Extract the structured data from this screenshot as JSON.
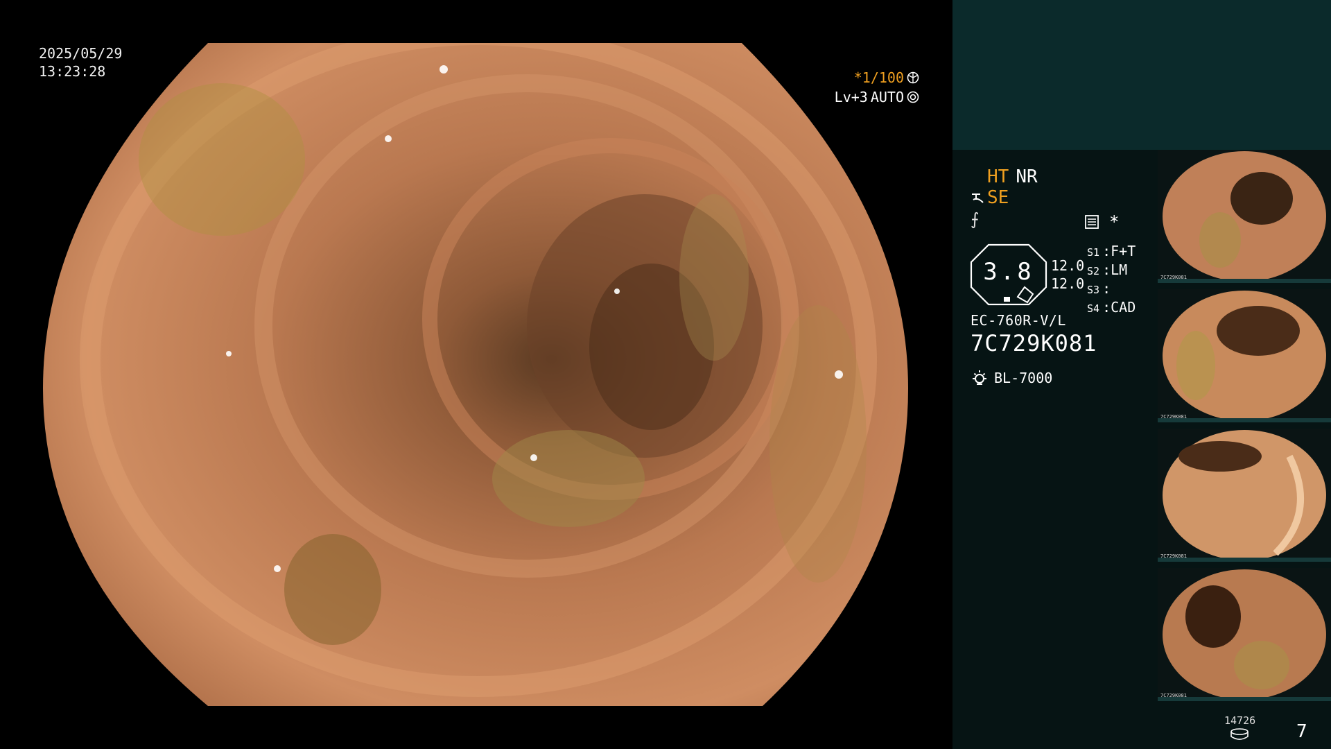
{
  "main": {
    "date": "2025/05/29",
    "time": "13:23:28",
    "shutter": "*1/100",
    "level": "Lv+3",
    "mode": "AUTO",
    "shutter_icon": "aperture-icon",
    "auto_icon": "iris-icon"
  },
  "status": {
    "ht": "HT",
    "nr": "NR",
    "se": "SE",
    "se_icon": "structure-enhance-icon",
    "f_glyph": "⨍",
    "menu_icon": "list-menu-icon",
    "asterisk": "*"
  },
  "zoom": {
    "value": "3.8",
    "num1": "12.0",
    "num2": "12.0"
  },
  "switches": [
    {
      "label": "S1",
      "value": "F+T"
    },
    {
      "label": "S2",
      "value": "LM"
    },
    {
      "label": "S3",
      "value": ""
    },
    {
      "label": "S4",
      "value": "CAD"
    }
  ],
  "scope": {
    "model": "EC-760R-V/L",
    "serial": "7C729K081",
    "light_source": "BL-7000",
    "light_icon": "light-source-icon"
  },
  "thumbnails": [
    {
      "label": "7C729K081"
    },
    {
      "label": "7C729K081"
    },
    {
      "label": "7C729K081"
    },
    {
      "label": "7C729K081"
    }
  ],
  "footer": {
    "count": "14726",
    "disk_icon": "storage-disk-icon",
    "page": "7"
  },
  "colors": {
    "accent_orange": "#f0a020",
    "panel_dark": "#061414",
    "panel_teal": "#0b2a2b"
  }
}
